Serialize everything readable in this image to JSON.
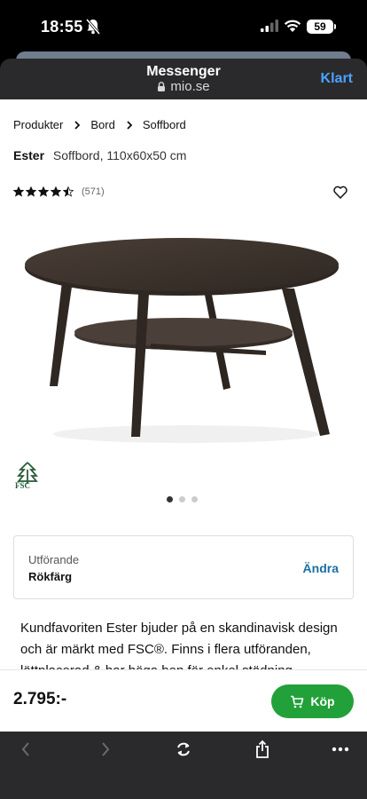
{
  "status_bar": {
    "time": "18:55",
    "battery": "59"
  },
  "sheet": {
    "title": "Messenger",
    "domain": "mio.se",
    "done_label": "Klart"
  },
  "breadcrumb": [
    "Produkter",
    "Bord",
    "Soffbord"
  ],
  "product": {
    "name": "Ester",
    "subtitle": "Soffbord, 110x60x50 cm",
    "rating": 4.5,
    "review_count": "(571)",
    "fsc_label": "FSC",
    "gallery": {
      "total": 3,
      "active": 1
    }
  },
  "variant": {
    "label": "Utförande",
    "value": "Rökfärg",
    "change_label": "Ändra"
  },
  "description": "Kundfavoriten Ester bjuder på en skandinavisk design och är märkt med FSC®. Finns i flera utföranden, lättplacerad & har höga ben för enkel städning.",
  "buy": {
    "price": "2.795:-",
    "button_label": "Köp"
  },
  "colors": {
    "buy_green": "#22a13b",
    "link_blue": "#1a6fa3",
    "done_blue": "#4aa3ff"
  },
  "toolbar": {
    "icons": [
      "back-icon",
      "forward-icon",
      "reload-icon",
      "share-icon",
      "more-icon"
    ]
  }
}
